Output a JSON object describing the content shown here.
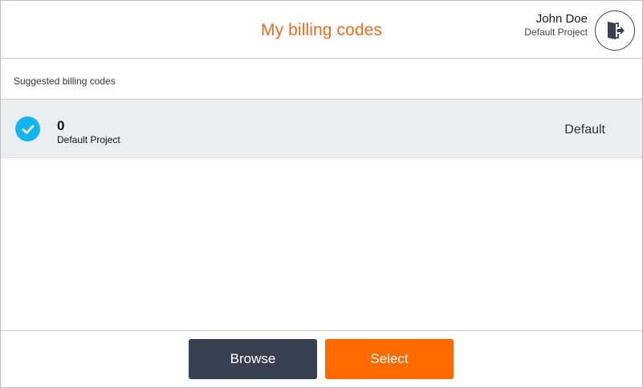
{
  "header": {
    "title": "My billing codes",
    "user_name": "John Doe",
    "user_project": "Default Project",
    "logout_icon": "logout-door-icon"
  },
  "suggested": {
    "label": "Suggested billing codes",
    "items": [
      {
        "code": "0",
        "project": "Default Project",
        "tag": "Default",
        "selected": true
      }
    ]
  },
  "footer": {
    "browse_label": "Browse",
    "select_label": "Select"
  },
  "colors": {
    "accent": "#f26a1b",
    "primary_button": "#ff6a00",
    "secondary_button": "#384152",
    "check": "#14b4ef"
  }
}
